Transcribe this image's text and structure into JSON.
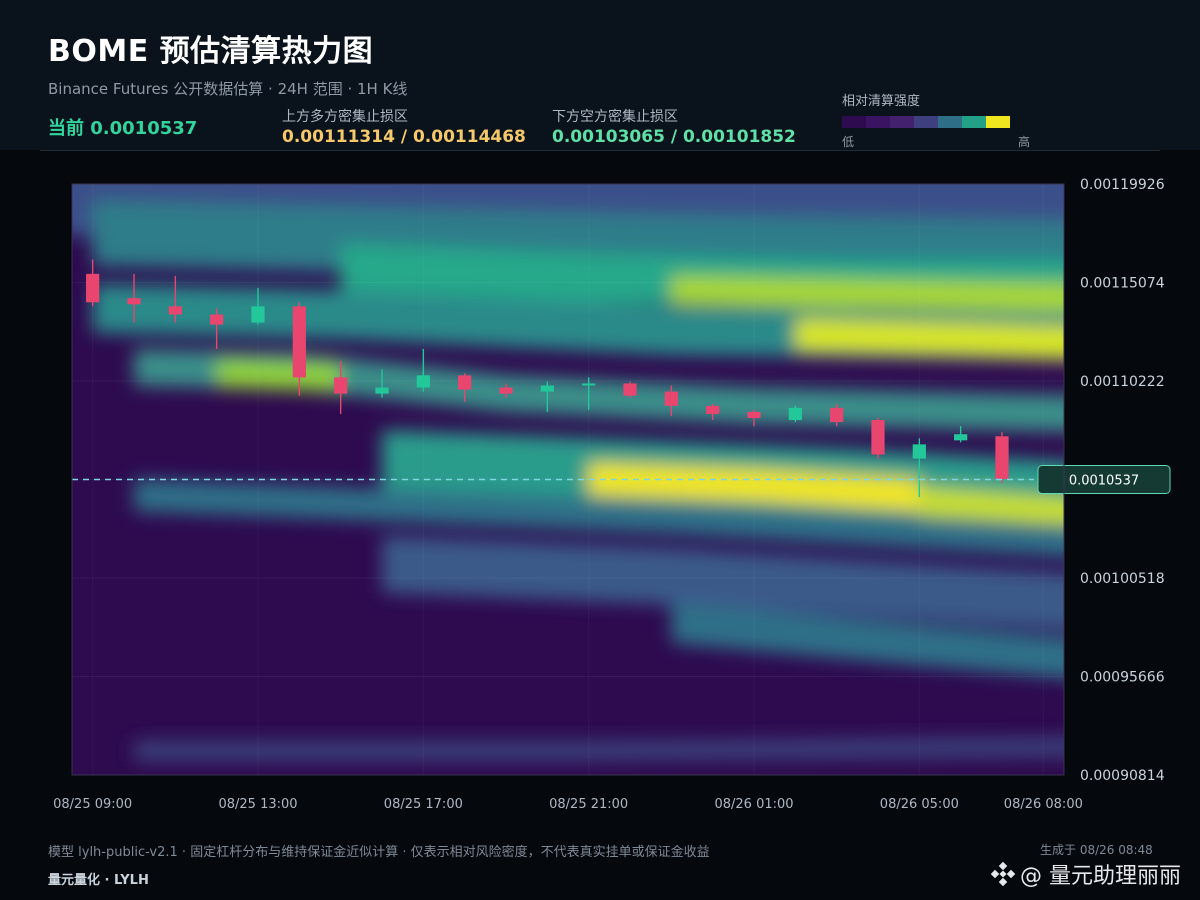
{
  "header": {
    "title": "BOME 预估清算热力图",
    "subtitle": "Binance Futures 公开数据估算 · 24H 范围 · 1H K线",
    "current_price_label": "当前 0.0010537",
    "upper_zone_label": "上方多方密集止损区",
    "upper_zone_values": "0.00111314 / 0.00114468",
    "lower_zone_label": "下方空方密集止损区",
    "lower_zone_values": "0.00103065 / 0.00101852"
  },
  "legend": {
    "title": "相对清算强度",
    "low_label": "低",
    "high_label": "高",
    "colors": [
      "#2e0a4f",
      "#3a1462",
      "#43216e",
      "#3e3f7f",
      "#2e6e86",
      "#22a187",
      "#f0e61f"
    ]
  },
  "footer": {
    "note": "模型 lylh-public-v2.1 · 固定杠杆分布与维持保证金近似计算 · 仅表示相对风险密度，不代表真实挂单或保证金收益",
    "brand": "量元量化 · LYLH",
    "generated": "生成于 08/26 08:48",
    "watermark": "@ 量元助理丽丽"
  },
  "chart_data": {
    "type": "heatmap",
    "title": "",
    "xlabel": "",
    "ylabel": "",
    "x_ticks": [
      "08/25 09:00",
      "08/25 13:00",
      "08/25 17:00",
      "08/25 21:00",
      "08/26 01:00",
      "08/26 05:00",
      "08/26 08:00"
    ],
    "x_tick_hours": [
      0,
      4,
      8,
      12,
      16,
      20,
      23
    ],
    "y_ticks": [
      "0.00119926",
      "0.00115074",
      "0.00110222",
      "0.00105370",
      "0.00100518",
      "0.00095666",
      "0.00090814"
    ],
    "y_tick_values": [
      0.00119926,
      0.00115074,
      0.00110222,
      0.0010537,
      0.00100518,
      0.00095666,
      0.00090814
    ],
    "y_tick_shown": [
      true,
      true,
      true,
      false,
      true,
      true,
      true
    ],
    "ylim": [
      0.00090814,
      0.00119926
    ],
    "xlim_hours": [
      -0.5,
      23.5
    ],
    "current_price": 0.0010537,
    "current_price_tag": "0.0010537",
    "colors": {
      "up": "#22c79a",
      "down": "#e8456f",
      "price_line": "#7fd6e0"
    },
    "candles": [
      {
        "h": 0,
        "o": 0.001155,
        "c": 0.001141,
        "hi": 0.001162,
        "lo": 0.001139
      },
      {
        "h": 1,
        "o": 0.001143,
        "c": 0.00114,
        "hi": 0.001155,
        "lo": 0.001131
      },
      {
        "h": 2,
        "o": 0.001139,
        "c": 0.001135,
        "hi": 0.001154,
        "lo": 0.001131
      },
      {
        "h": 3,
        "o": 0.001135,
        "c": 0.00113,
        "hi": 0.001138,
        "lo": 0.001118
      },
      {
        "h": 4,
        "o": 0.001131,
        "c": 0.001139,
        "hi": 0.001148,
        "lo": 0.00113
      },
      {
        "h": 5,
        "o": 0.001139,
        "c": 0.001104,
        "hi": 0.001141,
        "lo": 0.001095
      },
      {
        "h": 6,
        "o": 0.001104,
        "c": 0.001096,
        "hi": 0.001112,
        "lo": 0.001086
      },
      {
        "h": 7,
        "o": 0.001096,
        "c": 0.001099,
        "hi": 0.001108,
        "lo": 0.001094
      },
      {
        "h": 8,
        "o": 0.001099,
        "c": 0.001105,
        "hi": 0.001118,
        "lo": 0.001097
      },
      {
        "h": 9,
        "o": 0.001105,
        "c": 0.001098,
        "hi": 0.001106,
        "lo": 0.001092
      },
      {
        "h": 10,
        "o": 0.001099,
        "c": 0.001096,
        "hi": 0.001101,
        "lo": 0.001094
      },
      {
        "h": 11,
        "o": 0.001097,
        "c": 0.0011,
        "hi": 0.001102,
        "lo": 0.001087
      },
      {
        "h": 12,
        "o": 0.0011,
        "c": 0.001101,
        "hi": 0.001104,
        "lo": 0.001088
      },
      {
        "h": 13,
        "o": 0.001101,
        "c": 0.001095,
        "hi": 0.001102,
        "lo": 0.001094
      },
      {
        "h": 14,
        "o": 0.001097,
        "c": 0.00109,
        "hi": 0.0011,
        "lo": 0.001085
      },
      {
        "h": 15,
        "o": 0.00109,
        "c": 0.001086,
        "hi": 0.001091,
        "lo": 0.001083
      },
      {
        "h": 16,
        "o": 0.001087,
        "c": 0.001084,
        "hi": 0.001088,
        "lo": 0.00108
      },
      {
        "h": 17,
        "o": 0.001083,
        "c": 0.001089,
        "hi": 0.00109,
        "lo": 0.001082
      },
      {
        "h": 18,
        "o": 0.001089,
        "c": 0.001082,
        "hi": 0.001091,
        "lo": 0.00108
      },
      {
        "h": 19,
        "o": 0.001083,
        "c": 0.001066,
        "hi": 0.001084,
        "lo": 0.001064
      },
      {
        "h": 20,
        "o": 0.001064,
        "c": 0.001071,
        "hi": 0.001074,
        "lo": 0.001045
      },
      {
        "h": 21,
        "o": 0.001073,
        "c": 0.001076,
        "hi": 0.00108,
        "lo": 0.001072
      },
      {
        "h": 22,
        "o": 0.001075,
        "c": 0.001054,
        "hi": 0.001077,
        "lo": 0.001052
      }
    ]
  }
}
